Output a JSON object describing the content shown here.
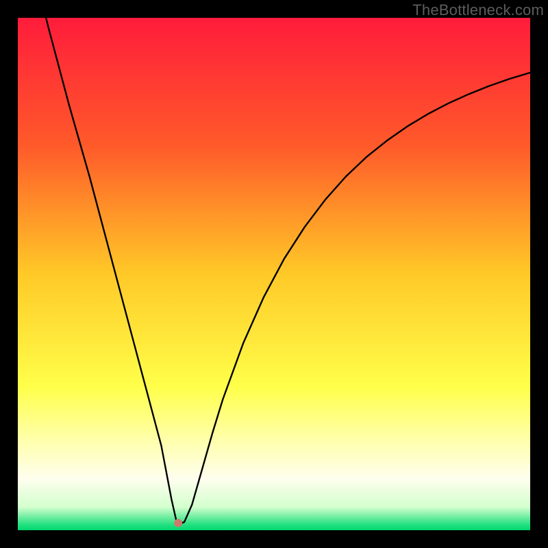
{
  "watermark": "TheBottleneck.com",
  "chart_data": {
    "type": "line",
    "title": "",
    "xlabel": "",
    "ylabel": "",
    "xlim": [
      0,
      100
    ],
    "ylim": [
      0,
      100
    ],
    "grid": false,
    "legend": false,
    "gradient_stops": [
      {
        "offset": 0.0,
        "color": "#ff1c3b"
      },
      {
        "offset": 0.25,
        "color": "#ff5a2a"
      },
      {
        "offset": 0.5,
        "color": "#ffc927"
      },
      {
        "offset": 0.72,
        "color": "#ffff4a"
      },
      {
        "offset": 0.82,
        "color": "#ffffa8"
      },
      {
        "offset": 0.9,
        "color": "#fefeee"
      },
      {
        "offset": 0.955,
        "color": "#d3ffcd"
      },
      {
        "offset": 0.99,
        "color": "#1fe07e"
      },
      {
        "offset": 1.0,
        "color": "#00d872"
      }
    ],
    "series": [
      {
        "name": "curve",
        "color": "#000000",
        "x": [
          4,
          6,
          8,
          10,
          12,
          14,
          16,
          18,
          20,
          22,
          24,
          26,
          28,
          30,
          30.9,
          31.6,
          32.5,
          34,
          36,
          38,
          40,
          44,
          48,
          52,
          56,
          60,
          64,
          68,
          72,
          76,
          80,
          84,
          88,
          92,
          96,
          100
        ],
        "y": [
          106,
          98,
          90.5,
          83,
          76,
          69,
          61.5,
          54,
          46.5,
          39,
          31.5,
          24,
          16.5,
          6,
          2,
          1.2,
          1.6,
          5,
          12,
          19,
          25.5,
          36.5,
          45.5,
          53,
          59.2,
          64.5,
          69,
          72.8,
          76,
          78.8,
          81.2,
          83.3,
          85.1,
          86.7,
          88.1,
          89.3
        ]
      }
    ],
    "marker": {
      "x": 31.3,
      "y": 1.4,
      "color": "#cd7a6c",
      "r": 6
    }
  }
}
